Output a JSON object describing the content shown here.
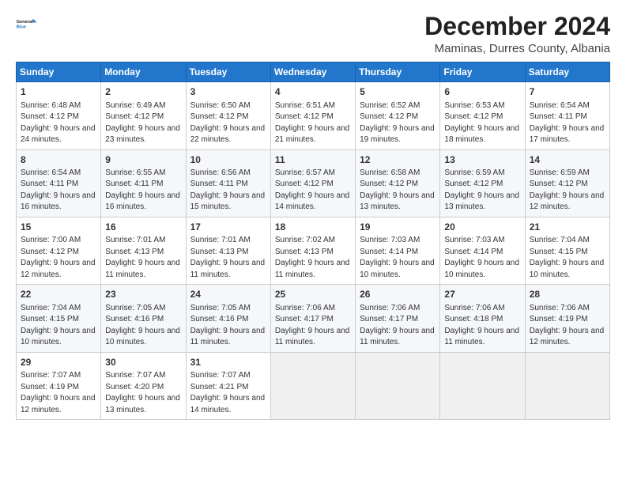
{
  "logo": {
    "line1": "General",
    "line2": "Blue"
  },
  "title": "December 2024",
  "subtitle": "Maminas, Durres County, Albania",
  "days_of_week": [
    "Sunday",
    "Monday",
    "Tuesday",
    "Wednesday",
    "Thursday",
    "Friday",
    "Saturday"
  ],
  "weeks": [
    [
      {
        "day": 1,
        "sunrise": "6:48 AM",
        "sunset": "4:12 PM",
        "daylight": "9 hours and 24 minutes."
      },
      {
        "day": 2,
        "sunrise": "6:49 AM",
        "sunset": "4:12 PM",
        "daylight": "9 hours and 23 minutes."
      },
      {
        "day": 3,
        "sunrise": "6:50 AM",
        "sunset": "4:12 PM",
        "daylight": "9 hours and 22 minutes."
      },
      {
        "day": 4,
        "sunrise": "6:51 AM",
        "sunset": "4:12 PM",
        "daylight": "9 hours and 21 minutes."
      },
      {
        "day": 5,
        "sunrise": "6:52 AM",
        "sunset": "4:12 PM",
        "daylight": "9 hours and 19 minutes."
      },
      {
        "day": 6,
        "sunrise": "6:53 AM",
        "sunset": "4:12 PM",
        "daylight": "9 hours and 18 minutes."
      },
      {
        "day": 7,
        "sunrise": "6:54 AM",
        "sunset": "4:11 PM",
        "daylight": "9 hours and 17 minutes."
      }
    ],
    [
      {
        "day": 8,
        "sunrise": "6:54 AM",
        "sunset": "4:11 PM",
        "daylight": "9 hours and 16 minutes."
      },
      {
        "day": 9,
        "sunrise": "6:55 AM",
        "sunset": "4:11 PM",
        "daylight": "9 hours and 16 minutes."
      },
      {
        "day": 10,
        "sunrise": "6:56 AM",
        "sunset": "4:11 PM",
        "daylight": "9 hours and 15 minutes."
      },
      {
        "day": 11,
        "sunrise": "6:57 AM",
        "sunset": "4:12 PM",
        "daylight": "9 hours and 14 minutes."
      },
      {
        "day": 12,
        "sunrise": "6:58 AM",
        "sunset": "4:12 PM",
        "daylight": "9 hours and 13 minutes."
      },
      {
        "day": 13,
        "sunrise": "6:59 AM",
        "sunset": "4:12 PM",
        "daylight": "9 hours and 13 minutes."
      },
      {
        "day": 14,
        "sunrise": "6:59 AM",
        "sunset": "4:12 PM",
        "daylight": "9 hours and 12 minutes."
      }
    ],
    [
      {
        "day": 15,
        "sunrise": "7:00 AM",
        "sunset": "4:12 PM",
        "daylight": "9 hours and 12 minutes."
      },
      {
        "day": 16,
        "sunrise": "7:01 AM",
        "sunset": "4:13 PM",
        "daylight": "9 hours and 11 minutes."
      },
      {
        "day": 17,
        "sunrise": "7:01 AM",
        "sunset": "4:13 PM",
        "daylight": "9 hours and 11 minutes."
      },
      {
        "day": 18,
        "sunrise": "7:02 AM",
        "sunset": "4:13 PM",
        "daylight": "9 hours and 11 minutes."
      },
      {
        "day": 19,
        "sunrise": "7:03 AM",
        "sunset": "4:14 PM",
        "daylight": "9 hours and 10 minutes."
      },
      {
        "day": 20,
        "sunrise": "7:03 AM",
        "sunset": "4:14 PM",
        "daylight": "9 hours and 10 minutes."
      },
      {
        "day": 21,
        "sunrise": "7:04 AM",
        "sunset": "4:15 PM",
        "daylight": "9 hours and 10 minutes."
      }
    ],
    [
      {
        "day": 22,
        "sunrise": "7:04 AM",
        "sunset": "4:15 PM",
        "daylight": "9 hours and 10 minutes."
      },
      {
        "day": 23,
        "sunrise": "7:05 AM",
        "sunset": "4:16 PM",
        "daylight": "9 hours and 10 minutes."
      },
      {
        "day": 24,
        "sunrise": "7:05 AM",
        "sunset": "4:16 PM",
        "daylight": "9 hours and 11 minutes."
      },
      {
        "day": 25,
        "sunrise": "7:06 AM",
        "sunset": "4:17 PM",
        "daylight": "9 hours and 11 minutes."
      },
      {
        "day": 26,
        "sunrise": "7:06 AM",
        "sunset": "4:17 PM",
        "daylight": "9 hours and 11 minutes."
      },
      {
        "day": 27,
        "sunrise": "7:06 AM",
        "sunset": "4:18 PM",
        "daylight": "9 hours and 11 minutes."
      },
      {
        "day": 28,
        "sunrise": "7:06 AM",
        "sunset": "4:19 PM",
        "daylight": "9 hours and 12 minutes."
      }
    ],
    [
      {
        "day": 29,
        "sunrise": "7:07 AM",
        "sunset": "4:19 PM",
        "daylight": "9 hours and 12 minutes."
      },
      {
        "day": 30,
        "sunrise": "7:07 AM",
        "sunset": "4:20 PM",
        "daylight": "9 hours and 13 minutes."
      },
      {
        "day": 31,
        "sunrise": "7:07 AM",
        "sunset": "4:21 PM",
        "daylight": "9 hours and 14 minutes."
      },
      null,
      null,
      null,
      null
    ]
  ]
}
